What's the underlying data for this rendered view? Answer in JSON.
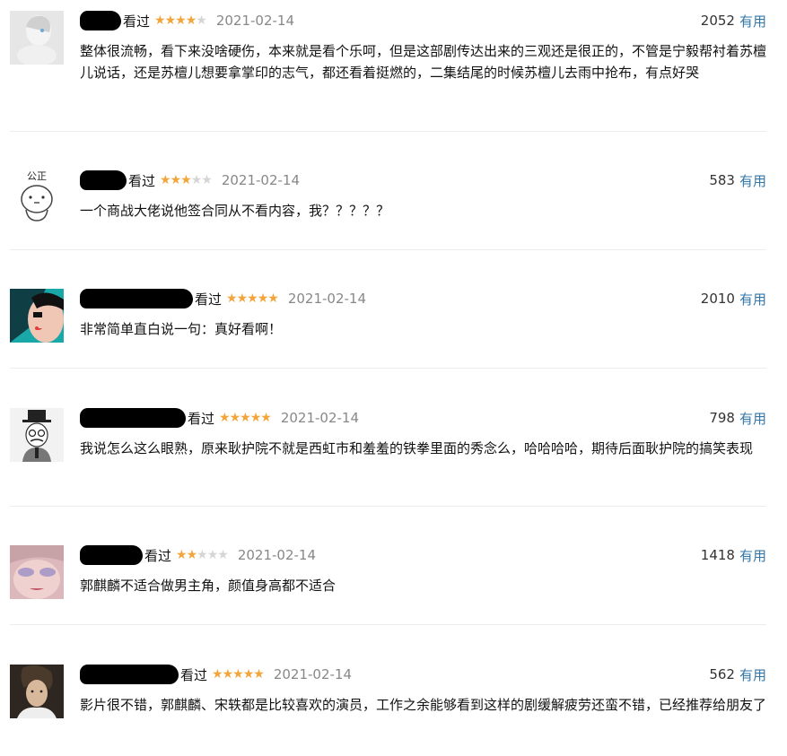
{
  "comments": [
    {
      "watched_label": "看过",
      "rating": 4,
      "date": "2021-02-14",
      "votes": "2052",
      "useful_label": "有用",
      "text": "整体很流畅，看下来没啥硬伤，本来就是看个乐呵，但是这部剧传达出来的三观还是很正的，不管是宁毅帮衬着苏檀儿说话，还是苏檀儿想要拿掌印的志气，都还看着挺燃的，二集结尾的时候苏檀儿去雨中抢布，有点好哭"
    },
    {
      "watched_label": "看过",
      "rating": 3,
      "date": "2021-02-14",
      "votes": "583",
      "useful_label": "有用",
      "avatar_text": "公正",
      "text": "一个商战大佬说他签合同从不看内容，我？？？？？"
    },
    {
      "watched_label": "看过",
      "rating": 5,
      "date": "2021-02-14",
      "votes": "2010",
      "useful_label": "有用",
      "text": "非常简单直白说一句：真好看啊！"
    },
    {
      "watched_label": "看过",
      "rating": 5,
      "date": "2021-02-14",
      "votes": "798",
      "useful_label": "有用",
      "text": "我说怎么这么眼熟，原来耿护院不就是西虹市和羞羞的铁拳里面的秀念么，哈哈哈哈，期待后面耿护院的搞笑表现"
    },
    {
      "watched_label": "看过",
      "rating": 2,
      "date": "2021-02-14",
      "votes": "1418",
      "useful_label": "有用",
      "text": "郭麒麟不适合做男主角，颜值身高都不适合"
    },
    {
      "watched_label": "看过",
      "rating": 5,
      "date": "2021-02-14",
      "votes": "562",
      "useful_label": "有用",
      "text": "影片很不错，郭麒麟、宋轶都是比较喜欢的演员，工作之余能够看到这样的剧缓解疲劳还蛮不错，已经推荐给朋友了"
    }
  ],
  "colors": {
    "star_on": "#f2a53a",
    "star_off": "#d5d5d5",
    "date": "#888888",
    "useful_link": "#3377aa",
    "divider": "#ededed"
  }
}
